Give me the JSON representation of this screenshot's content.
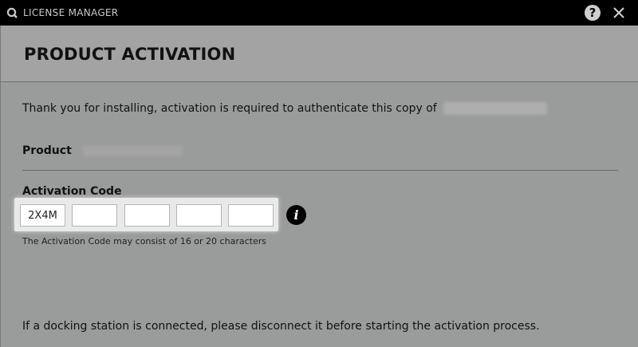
{
  "window": {
    "title": "LICENSE MANAGER",
    "logo_icon": "q-logo-icon",
    "help_icon": "question-icon",
    "help_label": "?",
    "close_icon": "close-icon"
  },
  "header": {
    "title": "PRODUCT ACTIVATION"
  },
  "main": {
    "intro_text": "Thank you for installing, activation is required to authenticate this copy of",
    "product_label": "Product",
    "activation_code_label": "Activation Code",
    "activation_code_fields": [
      {
        "value": "2X4M",
        "blurred": false
      },
      {
        "value": "",
        "blurred": true
      },
      {
        "value": "",
        "blurred": true
      },
      {
        "value": "",
        "blurred": true
      },
      {
        "value": "",
        "blurred": true
      }
    ],
    "info_icon": "info-icon",
    "info_label": "i",
    "hint_text": "The Activation Code may consist of 16 or 20 characters",
    "footer_text": "If a docking station is connected, please disconnect it before starting the activation process."
  },
  "colors": {
    "titlebar": "#000000",
    "background": "#9a9b9b",
    "header": "#a3a3a3",
    "text": "#111111"
  }
}
